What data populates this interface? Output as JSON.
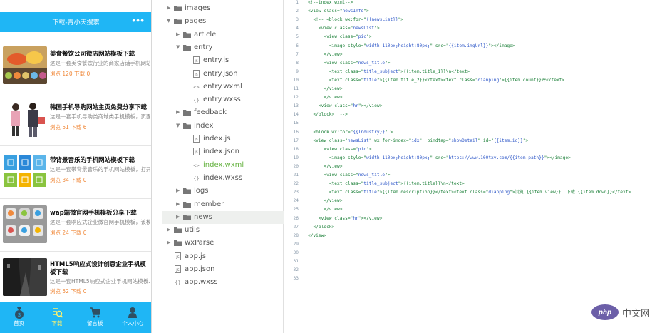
{
  "phone": {
    "nav_title": "下载-青小天搜索",
    "nav_more": "•••",
    "news": [
      {
        "title": "美食餐饮公司微店网站模板下载",
        "desc": "这是一套美食餐饮行业的商家店铺手机网站",
        "stats": "浏览 120 下载 0"
      },
      {
        "title": "韩国手机导购网站主页免费分享下载",
        "desc": "这是一套手机导购类商城类手机模板，页面...",
        "stats": "浏览 51 下载 6"
      },
      {
        "title": "带背景音乐的手机网站模板下载",
        "desc": "这是一套带背景音乐的手机网站模板，打开...",
        "stats": "浏览 34 下载 0"
      },
      {
        "title": "wap端微官网手机模板分享下载",
        "desc": "这是一套响应式企业微官网手机模板，该模...",
        "stats": "浏览 24 下载 0"
      },
      {
        "title": "HTML5响应式设计创意企业手机模板下载",
        "desc": "这是一套HTML5响应式企业手机网站模板...",
        "stats": "浏览 52 下载 0"
      }
    ],
    "tabs": [
      {
        "label": "首页",
        "icon": "money-bag-icon"
      },
      {
        "label": "下载",
        "icon": "search-list-icon"
      },
      {
        "label": "留言板",
        "icon": "cart-icon"
      },
      {
        "label": "个人中心",
        "icon": "user-icon"
      }
    ]
  },
  "tree": [
    {
      "name": "images",
      "type": "folder",
      "expanded": false,
      "depth": 0
    },
    {
      "name": "pages",
      "type": "folder",
      "expanded": true,
      "depth": 0
    },
    {
      "name": "article",
      "type": "folder",
      "expanded": false,
      "depth": 1
    },
    {
      "name": "entry",
      "type": "folder",
      "expanded": true,
      "depth": 1
    },
    {
      "name": "entry.js",
      "type": "js",
      "depth": 2
    },
    {
      "name": "entry.json",
      "type": "json",
      "depth": 2
    },
    {
      "name": "entry.wxml",
      "type": "wxml",
      "depth": 2
    },
    {
      "name": "entry.wxss",
      "type": "wxss",
      "depth": 2
    },
    {
      "name": "feedback",
      "type": "folder",
      "expanded": false,
      "depth": 1
    },
    {
      "name": "index",
      "type": "folder",
      "expanded": true,
      "depth": 1
    },
    {
      "name": "index.js",
      "type": "js",
      "depth": 2
    },
    {
      "name": "index.json",
      "type": "json",
      "depth": 2
    },
    {
      "name": "index.wxml",
      "type": "wxml",
      "depth": 2,
      "active": true
    },
    {
      "name": "index.wxss",
      "type": "wxss",
      "depth": 2
    },
    {
      "name": "logs",
      "type": "folder",
      "expanded": false,
      "depth": 1
    },
    {
      "name": "member",
      "type": "folder",
      "expanded": false,
      "depth": 1
    },
    {
      "name": "news",
      "type": "folder",
      "expanded": false,
      "depth": 1,
      "selected": true
    },
    {
      "name": "utils",
      "type": "folder",
      "expanded": false,
      "depth": 0
    },
    {
      "name": "wxParse",
      "type": "folder",
      "expanded": false,
      "depth": 0
    },
    {
      "name": "app.js",
      "type": "js",
      "depth": 0
    },
    {
      "name": "app.json",
      "type": "json",
      "depth": 0
    },
    {
      "name": "app.wxss",
      "type": "wxss",
      "depth": 0
    }
  ],
  "editor": {
    "lines": [
      {
        "n": "1",
        "code": "<!--index.wxml-->"
      },
      {
        "n": "2",
        "code": "<view class=\"newsInfo\">"
      },
      {
        "n": "3",
        "code": "  <!-- <block wx:for=\"{{newsList}}\">"
      },
      {
        "n": "4",
        "code": "    <view class=\"newsList\">"
      },
      {
        "n": "5",
        "code": "      <view class=\"pic\">"
      },
      {
        "n": "6",
        "code": "        <image style=\"width:110px;height:80px;\" src=\"{{item.imgUrl}}\"></image>"
      },
      {
        "n": "7",
        "code": "      </view>"
      },
      {
        "n": "8",
        "code": "      <view class=\"news_title\">"
      },
      {
        "n": "9",
        "code": "        <text class=\"title_subject\">{{item.title_1}}\\n</text>"
      },
      {
        "n": "10",
        "code": "        <text class=\"title\">{{item.title_2}}</text><text class=\"dianping\">{{item.count}}评</text>"
      },
      {
        "n": "11",
        "code": "      </view>"
      },
      {
        "n": "12",
        "code": "      </view>"
      },
      {
        "n": "13",
        "code": "    <view class=\"hr\"></view>"
      },
      {
        "n": "14",
        "code": "  </block>  -->"
      },
      {
        "n": "15",
        "code": ""
      },
      {
        "n": "16",
        "code": "  <block wx:for=\"{{Industry}}\" >"
      },
      {
        "n": "17",
        "code": "  <view class=\"newsList\" wx:for-index=\"idx\"  bindtap=\"showDetail\" id=\"{{item.id}}\">"
      },
      {
        "n": "18",
        "code": "      <view class=\"pic\">"
      },
      {
        "n": "19",
        "code": "        <image style=\"width:110px;height:80px;\" src=\"https://www.100txy.com/{{item.path}}\"></image>"
      },
      {
        "n": "20",
        "code": "      </view>"
      },
      {
        "n": "21",
        "code": "      <view class=\"news_title\">"
      },
      {
        "n": "22",
        "code": "        <text class=\"title_subject\">{{item.title}}\\n</text>"
      },
      {
        "n": "23",
        "code": "        <text class=\"title\">{{item.description}}</text><text class=\"dianping\">浏览 {{item.view}}  下载 {{item.down}}</text>"
      },
      {
        "n": "24",
        "code": "      </view>"
      },
      {
        "n": "25",
        "code": "      </view>"
      },
      {
        "n": "26",
        "code": "    <view class=\"hr\"></view>"
      },
      {
        "n": "27",
        "code": "  </block>"
      },
      {
        "n": "28",
        "code": "</view>"
      },
      {
        "n": "29",
        "code": ""
      },
      {
        "n": "30",
        "code": ""
      },
      {
        "n": "31",
        "code": ""
      },
      {
        "n": "32",
        "code": ""
      },
      {
        "n": "33",
        "code": ""
      }
    ]
  },
  "watermark": {
    "logo": "php",
    "text": "中文网"
  },
  "colors": {
    "accent": "#1fb6f5",
    "tab_active": "#fff16d",
    "stats": "#f08a3c",
    "code": "#1a7f37",
    "string": "#2b55c7"
  }
}
